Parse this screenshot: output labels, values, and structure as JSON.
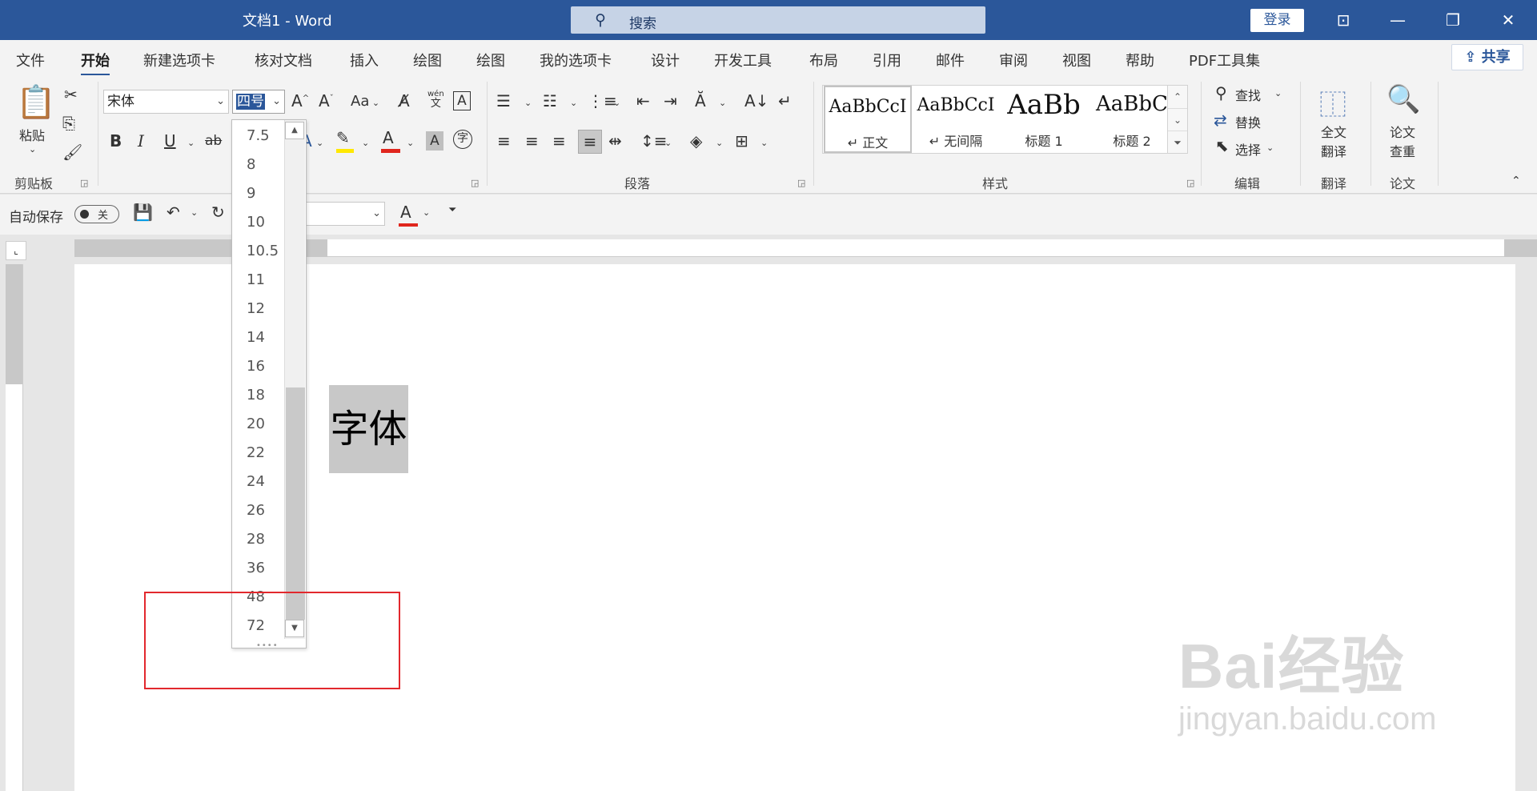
{
  "window": {
    "title": "文档1 - Word"
  },
  "search": {
    "placeholder": "搜索",
    "icon": "search-icon"
  },
  "account": {
    "login_label": "登录"
  },
  "window_controls": {
    "ribbon_display": "⊡",
    "minimize": "—",
    "restore": "❐",
    "close": "✕"
  },
  "menu_tabs": [
    "文件",
    "开始",
    "新建选项卡",
    "核对文档",
    "插入",
    "绘图",
    "绘图",
    "我的选项卡",
    "设计",
    "开发工具",
    "布局",
    "引用",
    "邮件",
    "审阅",
    "视图",
    "帮助",
    "PDF工具集"
  ],
  "active_tab": "开始",
  "share_label": "共享",
  "ribbon": {
    "clipboard": {
      "paste_label": "粘贴",
      "group_label": "剪贴板"
    },
    "font": {
      "font_name": "宋体",
      "font_size": "四号",
      "case_label": "Aa",
      "pinyin_top": "wén",
      "pinyin_bottom": "文"
    },
    "paragraph": {
      "group_label": "段落"
    },
    "styles": {
      "group_label": "样式",
      "items": [
        {
          "sample": "AaBbCcI",
          "name": "正文",
          "marker": "↵"
        },
        {
          "sample": "AaBbCcI",
          "name": "无间隔",
          "marker": "↵"
        },
        {
          "sample": "AaBb",
          "name": "标题 1"
        },
        {
          "sample": "AaBbC",
          "name": "标题 2"
        }
      ]
    },
    "editing": {
      "group_label": "编辑",
      "find_label": "查找",
      "replace_label": "替换",
      "select_label": "选择"
    },
    "translate": {
      "button_label_1": "全文",
      "button_label_2": "翻译",
      "group_label": "翻译"
    },
    "paper": {
      "button_label_1": "论文",
      "button_label_2": "查重",
      "group_label": "论文"
    }
  },
  "quick_access": {
    "autosave_label": "自动保存",
    "toggle_state": "关"
  },
  "font_size_options": [
    "7.5",
    "8",
    "9",
    "10",
    "10.5",
    "11",
    "12",
    "14",
    "16",
    "18",
    "20",
    "22",
    "24",
    "26",
    "28",
    "36",
    "48",
    "72"
  ],
  "document": {
    "text": "字体"
  },
  "watermark": {
    "main": "Bai经验",
    "sub": "jingyan.baidu.com"
  },
  "colors": {
    "title_bar": "#2b579a",
    "highlight_box": "#e2282d",
    "font_color_bar": "#e0261d",
    "highlight_color_bar": "#ffe800"
  }
}
